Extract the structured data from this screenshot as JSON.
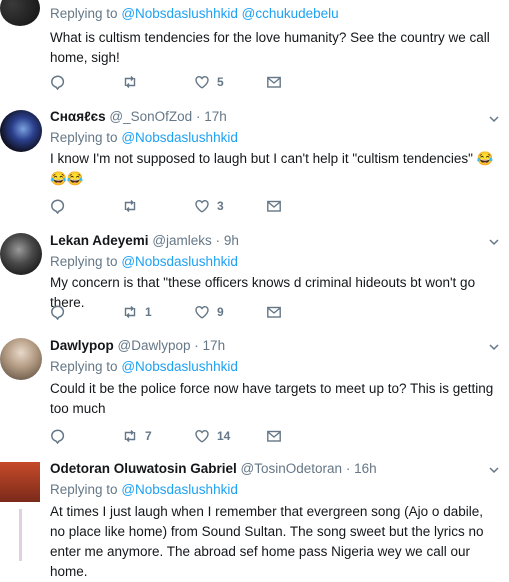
{
  "tweets": [
    {
      "reply_label": "Replying to",
      "reply_to": [
        "@Nobsdaslushhkid",
        "@cchukudebelu"
      ],
      "text": "What is cultism tendencies for the love humanity? See the country we call home, sigh!",
      "retweets": "",
      "likes": "5"
    },
    {
      "name": "Cнαяℓєѕ",
      "handle": "@_SonOfZod",
      "time": "17h",
      "reply_label": "Replying to",
      "reply_to": [
        "@Nobsdaslushhkid"
      ],
      "text": "I know I'm not supposed to laugh but I can't help it \"cultism tendencies\" 😂😂😂",
      "retweets": "",
      "likes": "3"
    },
    {
      "name": "Lekan Adeyemi",
      "handle": "@jamleks",
      "time": "9h",
      "reply_label": "Replying to",
      "reply_to": [
        "@Nobsdaslushhkid"
      ],
      "text": "My concern is that \"these officers knows d criminal hideouts bt won't go there.",
      "retweets": "1",
      "likes": "9"
    },
    {
      "name": "Dawlypop",
      "handle": "@Dawlypop",
      "time": "17h",
      "reply_label": "Replying to",
      "reply_to": [
        "@Nobsdaslushhkid"
      ],
      "text": "Could it be the police force now have targets to meet up to? This is getting too much",
      "retweets": "7",
      "likes": "14"
    },
    {
      "name": "Odetoran Oluwatosin Gabriel",
      "handle": "@TosinOdetoran",
      "time": "16h",
      "reply_label": "Replying to",
      "reply_to": [
        "@Nobsdaslushhkid"
      ],
      "text": "At times I just laugh when I remember that evergreen song (Ajo o dabile, no place like home) from Sound Sultan. The song sweet but the lyrics no enter me anymore. The abroad sef home pass Nigeria wey we call our home.",
      "retweets": "",
      "likes": ""
    }
  ],
  "dot": "·",
  "icons": [
    "reply-icon",
    "retweet-icon",
    "like-icon",
    "message-icon",
    "caret-down-icon"
  ],
  "colors": {
    "text": "#14171a",
    "muted": "#657786",
    "link": "#1da1f2",
    "divider": "#e6ecf0"
  }
}
